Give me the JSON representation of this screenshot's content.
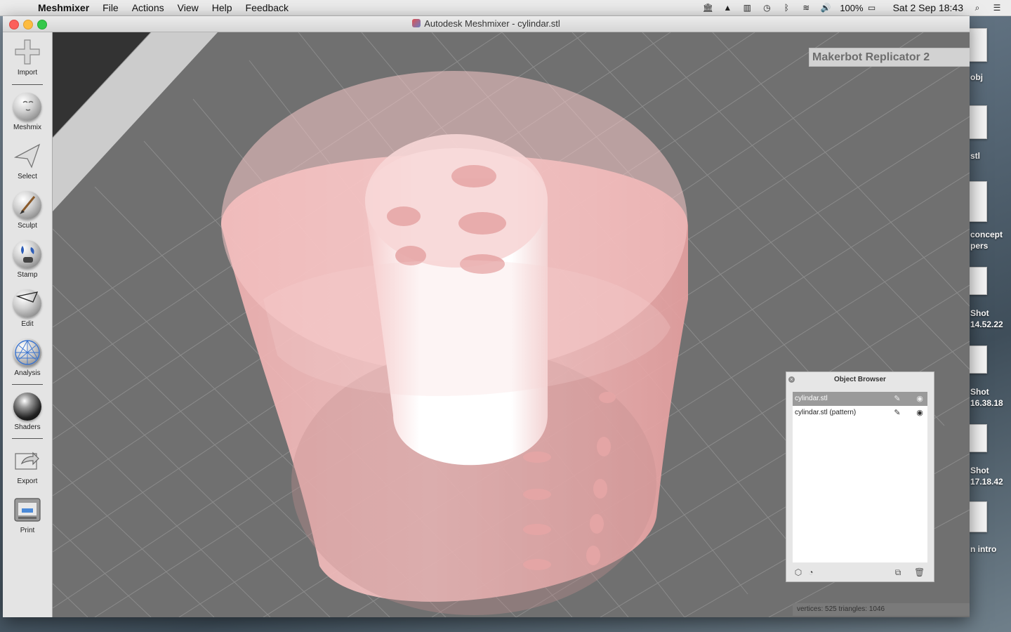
{
  "menubar": {
    "app_name": "Meshmixer",
    "menus": [
      "File",
      "Actions",
      "View",
      "Help",
      "Feedback"
    ],
    "battery_percent": "100%",
    "clock": "Sat 2 Sep  18:43",
    "status_icons": [
      "bank-icon",
      "drive-icon",
      "battery-meter-icon",
      "time-machine-icon",
      "bluetooth-icon",
      "wifi-icon",
      "volume-icon",
      "battery-icon",
      "search-icon",
      "list-icon"
    ]
  },
  "desktop": {
    "labels": [
      "obj",
      "stl",
      "concept",
      "pers",
      "Shot",
      "14.52.22",
      "Shot",
      "16.38.18",
      "Shot",
      "17.18.42",
      "n intro"
    ]
  },
  "window": {
    "title": "Autodesk Meshmixer - cylindar.stl"
  },
  "toolbar": {
    "tools": [
      {
        "label": "Import",
        "icon": "plus-icon"
      },
      {
        "label": "Meshmix",
        "icon": "meshmix-head-icon"
      },
      {
        "label": "Select",
        "icon": "select-arrow-icon"
      },
      {
        "label": "Sculpt",
        "icon": "sculpt-brush-icon"
      },
      {
        "label": "Stamp",
        "icon": "stamp-icon"
      },
      {
        "label": "Edit",
        "icon": "edit-sphere-icon"
      },
      {
        "label": "Analysis",
        "icon": "analysis-mesh-icon"
      },
      {
        "label": "Shaders",
        "icon": "shader-ball-icon"
      },
      {
        "label": "Export",
        "icon": "export-icon"
      },
      {
        "label": "Print",
        "icon": "printer-icon"
      }
    ]
  },
  "printer_selector": {
    "value": "Makerbot Replicator 2"
  },
  "object_browser": {
    "title": "Object Browser",
    "objects": [
      {
        "name": "cylindar.stl",
        "selected": true
      },
      {
        "name": "cylindar.stl (pattern)",
        "selected": false
      }
    ]
  },
  "status": {
    "text": "vertices: 525 triangles: 1046"
  }
}
